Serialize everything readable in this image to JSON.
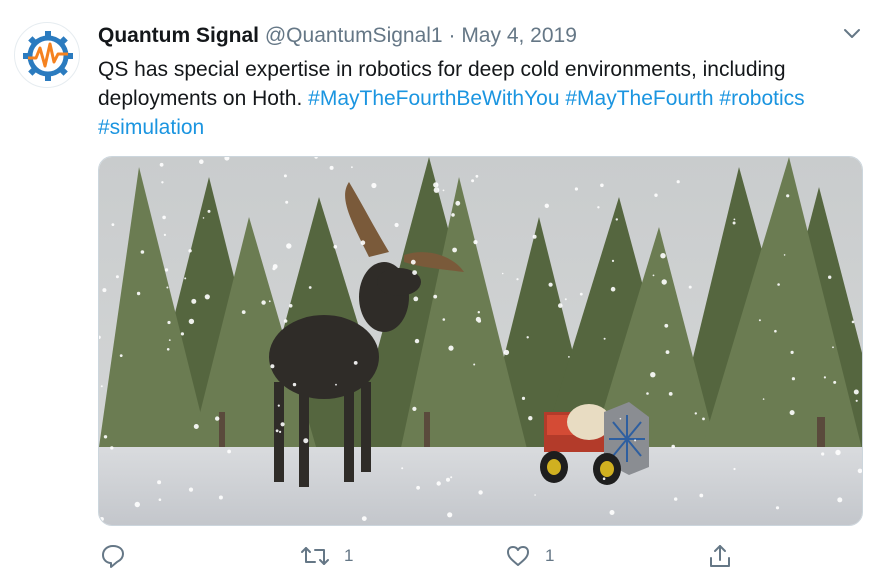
{
  "tweet": {
    "display_name": "Quantum Signal",
    "handle": "@QuantumSignal1",
    "separator": "·",
    "date": "May 4, 2019",
    "text_plain": "QS has special expertise in robotics for deep cold environments, including deployments on Hoth.",
    "hashtags": [
      "#MayTheFourthBeWithYou",
      "#MayTheFourth",
      "#robotics",
      "#simulation"
    ]
  },
  "actions": {
    "reply": {
      "icon": "reply-icon",
      "count": ""
    },
    "retweet": {
      "icon": "retweet-icon",
      "count": "1"
    },
    "like": {
      "icon": "heart-icon",
      "count": "1"
    },
    "share": {
      "icon": "share-icon",
      "count": ""
    }
  },
  "colors": {
    "link": "#1b95e0",
    "secondary_text": "#657786",
    "primary_text": "#14171a",
    "logo_orange": "#f5821f",
    "logo_blue": "#2b7bbf"
  },
  "media": {
    "description_icon": "image"
  }
}
